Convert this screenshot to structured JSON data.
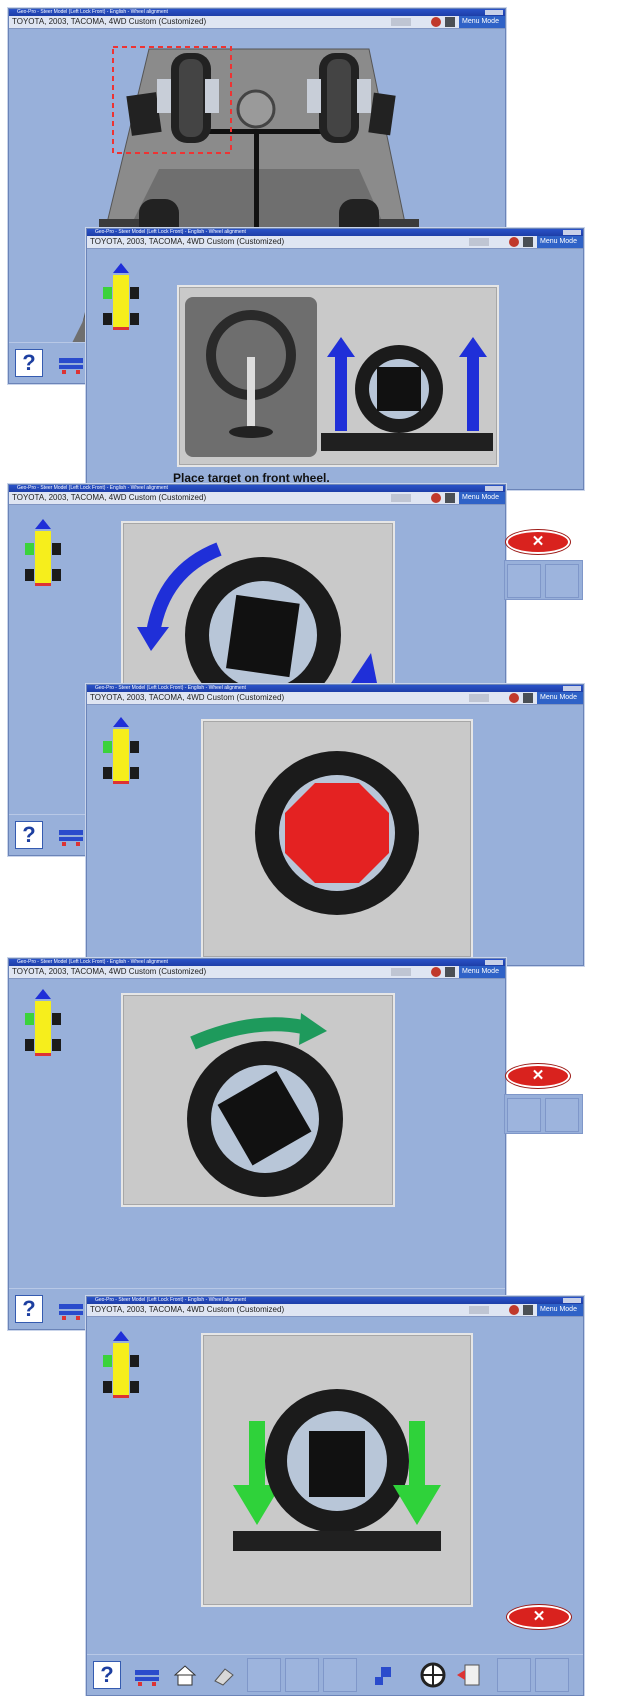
{
  "titlebar_text": "Geo-Pro - Steer Model (Left Lock Front) - English - Wheel alignment",
  "vehicle_info": "TOYOTA, 2003, TACOMA, 4WD Custom (Customized)",
  "menu_mode": "Menu Mode",
  "caption": "Place target on front wheel.",
  "exit_label": "✕",
  "help_label": "?",
  "colors": {
    "window_bg": "#98b0da",
    "panel_bg": "#c9c9c9",
    "arrow_blue": "#1f2fd8",
    "arrow_green": "#2fd23a",
    "target_red": "#e42222",
    "indicator_yellow": "#f6ee1c"
  },
  "icons": [
    "help-icon",
    "alignment-icon",
    "home-icon",
    "eraser-icon",
    "target-icon",
    "exit-icon"
  ]
}
